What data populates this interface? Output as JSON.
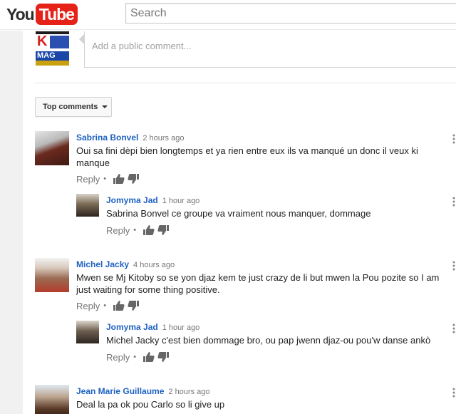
{
  "header": {
    "logo_you": "You",
    "logo_tube": "Tube",
    "search_placeholder": "Search"
  },
  "comment_box": {
    "channel_logo_k": "K",
    "channel_logo_mag": "MAG",
    "placeholder": "Add a public comment..."
  },
  "sort": {
    "label": "Top comments"
  },
  "comments": [
    {
      "author": "Sabrina Bonvel",
      "time": "2 hours ago",
      "text": "Oui sa fini dèpi bien longtemps et ya rien entre eux ils va manqué un donc il veux ki manque",
      "reply_label": "Reply",
      "separator": "•"
    },
    {
      "author": "Jomyma Jad",
      "time": "1 hour ago",
      "text": "Sabrina Bonvel ce groupe va vraiment nous manquer, dommage",
      "reply_label": "Reply",
      "separator": "•"
    },
    {
      "author": "Michel Jacky",
      "time": "4 hours ago",
      "text": "Mwen se Mj Kitoby so se yon djaz kem te just crazy  de li but mwen la Pou pozite so I am just waiting for some thing positive.",
      "reply_label": "Reply",
      "separator": "•"
    },
    {
      "author": "Jomyma Jad",
      "time": "1 hour ago",
      "text": "Michel Jacky c'est bien dommage bro, ou pap jwenn djaz-ou pou'w danse ankò",
      "reply_label": "Reply",
      "separator": "•"
    },
    {
      "author": "Jean Marie Guillaume",
      "time": "2 hours ago",
      "text": "Deal la pa ok pou Carlo so li give up"
    }
  ],
  "colors": {
    "author_link": "#1f62c1",
    "youtube_red": "#e62117"
  }
}
